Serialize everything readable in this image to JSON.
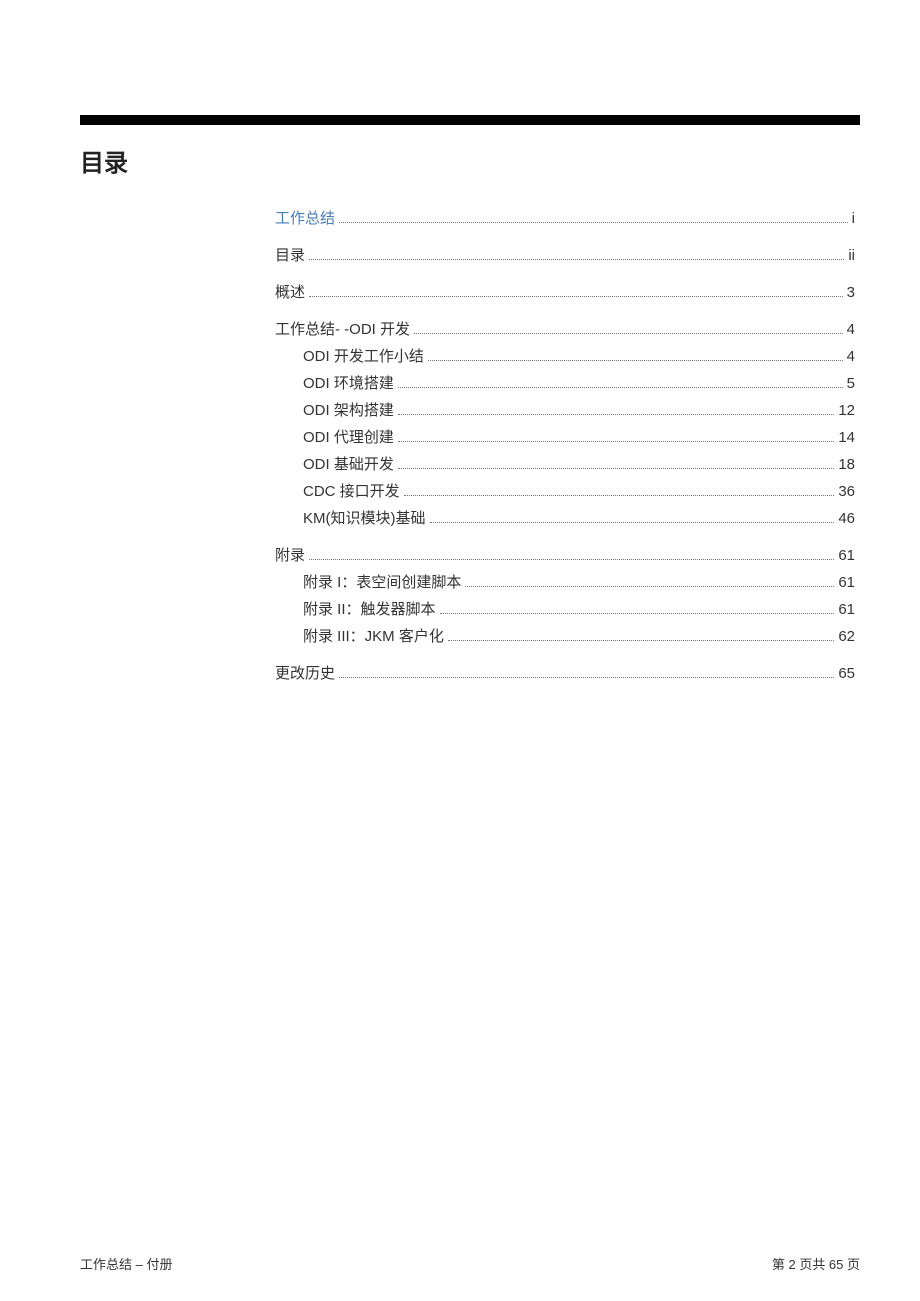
{
  "title": "目录",
  "toc": {
    "items": [
      {
        "label": "工作总结",
        "page": "i",
        "level": 0,
        "link": true
      },
      {
        "label": "目录",
        "page": "ii",
        "level": 0,
        "link": false
      },
      {
        "label": "概述",
        "page": "3",
        "level": 0,
        "link": false
      },
      {
        "label": "工作总结- -ODI 开发",
        "page": "4",
        "level": 0,
        "link": false
      },
      {
        "label": "ODI 开发工作小结",
        "page": "4",
        "level": 1,
        "link": false
      },
      {
        "label": "ODI 环境搭建",
        "page": "5",
        "level": 1,
        "link": false
      },
      {
        "label": "ODI 架构搭建",
        "page": "12",
        "level": 1,
        "link": false
      },
      {
        "label": "ODI 代理创建",
        "page": "14",
        "level": 1,
        "link": false
      },
      {
        "label": "ODI 基础开发",
        "page": "18",
        "level": 1,
        "link": false
      },
      {
        "label": "CDC 接口开发",
        "page": "36",
        "level": 1,
        "link": false
      },
      {
        "label": "KM(知识模块)基础",
        "page": "46",
        "level": 1,
        "link": false
      },
      {
        "label": "附录",
        "page": "61",
        "level": 0,
        "link": false
      },
      {
        "label": "附录 I：表空间创建脚本",
        "page": "61",
        "level": 1,
        "link": false
      },
      {
        "label": "附录 II：触发器脚本",
        "page": "61",
        "level": 1,
        "link": false
      },
      {
        "label": "附录 III：JKM 客户化",
        "page": "62",
        "level": 1,
        "link": false
      },
      {
        "label": "更改历史",
        "page": "65",
        "level": 0,
        "link": false
      }
    ]
  },
  "footer": {
    "left": "工作总结 – 付册",
    "right": "第 2 页共 65 页"
  }
}
